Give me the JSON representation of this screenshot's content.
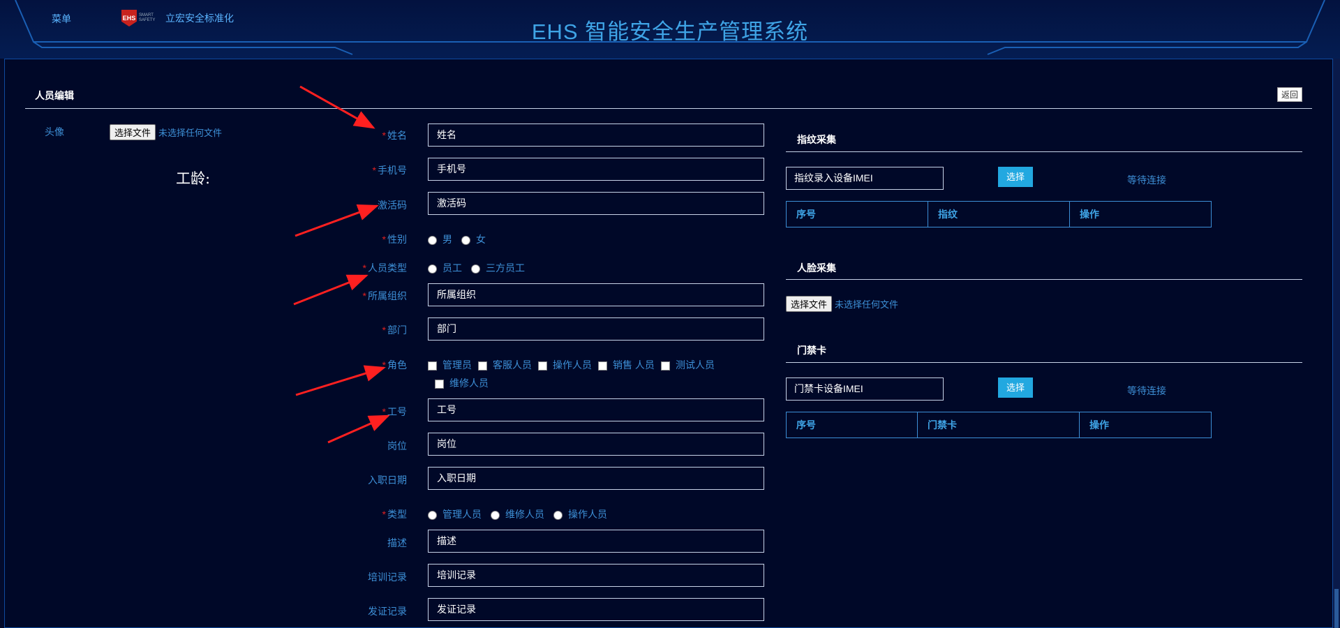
{
  "header": {
    "menu_label": "菜单",
    "logo_badge": "EHS",
    "logo_sub": "SMART SAFETY",
    "logo_text": "立宏安全标准化",
    "title": "EHS 智能安全生产管理系统"
  },
  "section": {
    "title": "人员编辑",
    "back_label": "返回"
  },
  "avatar": {
    "label": "头像",
    "file_button": "选择文件",
    "file_status": "未选择任何文件"
  },
  "seniority_label": "工龄:",
  "form": {
    "name": {
      "label": "姓名",
      "value": "姓名"
    },
    "phone": {
      "label": "手机号",
      "value": "手机号"
    },
    "activation": {
      "label": "激活码",
      "value": "激活码"
    },
    "gender": {
      "label": "性别",
      "options": [
        "男",
        "女"
      ]
    },
    "person_type": {
      "label": "人员类型",
      "options": [
        "员工",
        "三方员工"
      ]
    },
    "org": {
      "label": "所属组织",
      "value": "所属组织"
    },
    "dept": {
      "label": "部门",
      "value": "部门"
    },
    "role": {
      "label": "角色",
      "options": [
        "管理员",
        "客服人员",
        "操作人员",
        "销售 人员",
        "测试人员",
        "维修人员"
      ]
    },
    "job_no": {
      "label": "工号",
      "value": "工号"
    },
    "position": {
      "label": "岗位",
      "value": "岗位"
    },
    "hire_date": {
      "label": "入职日期",
      "value": "入职日期"
    },
    "type": {
      "label": "类型",
      "options": [
        "管理人员",
        "维修人员",
        "操作人员"
      ]
    },
    "desc": {
      "label": "描述",
      "value": "描述"
    },
    "training": {
      "label": "培训记录",
      "value": "培训记录"
    },
    "cert": {
      "label": "发证记录",
      "value": "发证记录"
    }
  },
  "fingerprint": {
    "title": "指纹采集",
    "device_placeholder": "指纹录入设备IMEI",
    "select_label": "选择",
    "status": "等待连接",
    "columns": [
      "序号",
      "指纹",
      "操作"
    ]
  },
  "face": {
    "title": "人脸采集",
    "file_button": "选择文件",
    "file_status": "未选择任何文件"
  },
  "card": {
    "title": "门禁卡",
    "device_placeholder": "门禁卡设备IMEI",
    "select_label": "选择",
    "status": "等待连接",
    "columns": [
      "序号",
      "门禁卡",
      "操作"
    ]
  },
  "colors": {
    "accent": "#3d8fd6",
    "required": "#e02020",
    "button": "#22a8e0",
    "arrow": "#ff2020"
  }
}
